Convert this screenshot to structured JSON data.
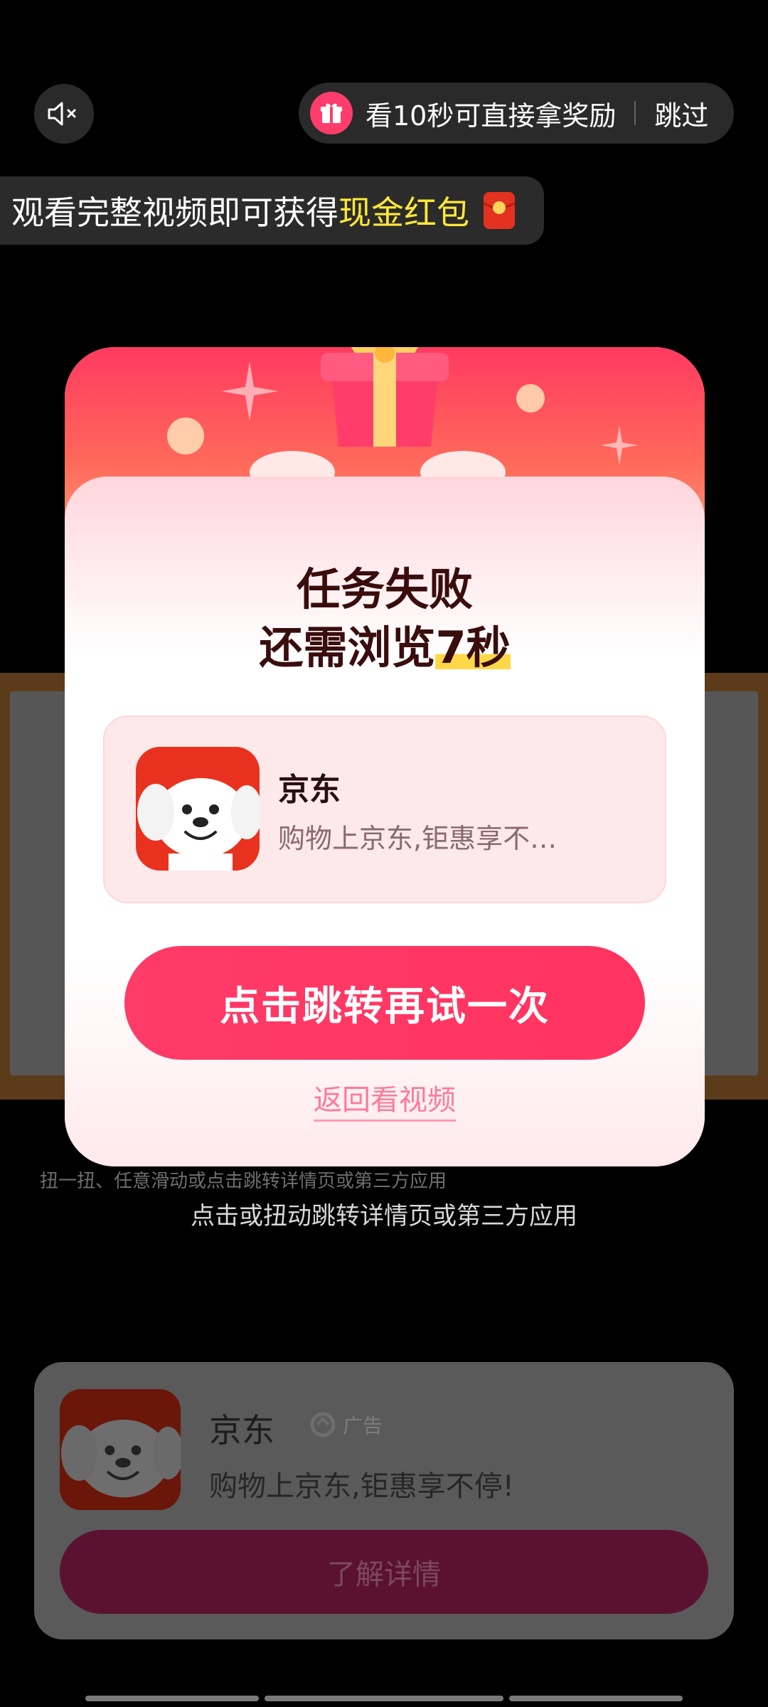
{
  "top": {
    "reward_text": "看10秒可直接拿奖励",
    "skip_label": "跳过"
  },
  "banner": {
    "prefix": "观看完整视频即可获得",
    "highlight": "现金红包"
  },
  "modal": {
    "title_line1": "任务失败",
    "title_line2_prefix": "还需浏览",
    "title_line2_highlight": "7秒",
    "app_name": "京东",
    "app_desc": "购物上京东,钜惠享不…",
    "retry_label": "点击跳转再试一次",
    "back_label": "返回看视频"
  },
  "hints": {
    "shake_text": "扭一扭、任意滑动或点击跳转详情页或第三方应用",
    "jump_text": "点击或扭动跳转详情页或第三方应用"
  },
  "ad": {
    "app_name": "京东",
    "badge_label": "广告",
    "desc": "购物上京东,钜惠享不停!",
    "button_label": "了解详情"
  },
  "colors": {
    "accent": "#ff3b67",
    "highlight_yellow": "#ffe83a"
  },
  "icons": [
    "speaker-mute-icon",
    "gift-icon",
    "red-packet-icon",
    "gift-box-illustration",
    "jd-mascot-icon",
    "ad-logo-icon"
  ]
}
